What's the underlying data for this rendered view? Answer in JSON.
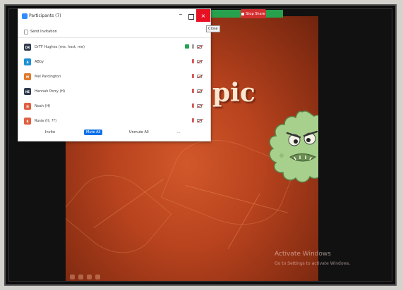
{
  "window": {
    "title": "Participants (7)",
    "minimize": "–",
    "close": "×",
    "close_tooltip": "Close"
  },
  "invite": {
    "label": "Send Invitation"
  },
  "participants": [
    {
      "initials": "DR",
      "color": "#2f3b4c",
      "name": "DrTF Hughes (me, host, me)",
      "sharing": true,
      "mic_muted": false,
      "video_off": true
    },
    {
      "initials": "A",
      "color": "#1f8fd6",
      "name": "ABby",
      "sharing": false,
      "mic_muted": true,
      "video_off": true
    },
    {
      "initials": "M",
      "color": "#e0792c",
      "name": "Mel Pardington",
      "sharing": false,
      "mic_muted": true,
      "video_off": true
    },
    {
      "initials": "HE",
      "color": "#2f3b4c",
      "name": "Hannah Perry (H)",
      "sharing": false,
      "mic_muted": true,
      "video_off": true
    },
    {
      "initials": "N",
      "color": "#e06040",
      "name": "Noah (H)",
      "sharing": false,
      "mic_muted": true,
      "video_off": true
    },
    {
      "initials": "R",
      "color": "#e06040",
      "name": "Rosie (H, ??)",
      "sharing": false,
      "mic_muted": true,
      "video_off": true
    }
  ],
  "footer": {
    "invite_label": "Invite",
    "mute_all_label": "Mute All",
    "unmute_all_label": "Unmute All",
    "more_label": "..."
  },
  "meeting_bar": {
    "stop_share_label": "Stop Share",
    "color": "#27a14d"
  },
  "slide": {
    "title_partial": "pic",
    "watermark_line1": "Activate Windows",
    "watermark_line2": "Go to Settings to activate Windows."
  },
  "colors": {
    "slide_bg": "#b8431e",
    "germ_fill": "#a8d08d",
    "primary_button": "#0e71eb",
    "close_button": "#e81123"
  },
  "icons": [
    "zoom-app-icon",
    "invite-icon",
    "share-screen-icon",
    "mic-icon",
    "camera-off-icon",
    "germ-illustration"
  ]
}
